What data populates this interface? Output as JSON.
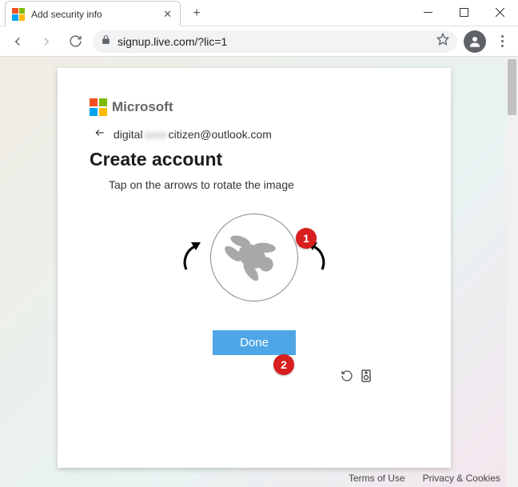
{
  "browser": {
    "tab_title": "Add security info",
    "url": "signup.live.com/?lic=1"
  },
  "page": {
    "brand": "Microsoft",
    "email_prefix": "digital",
    "email_blur": "xxxx",
    "email_suffix": "citizen@outlook.com",
    "heading": "Create account",
    "instruction": "Tap on the arrows to rotate the image",
    "done_label": "Done"
  },
  "annotations": {
    "step1": "1",
    "step2": "2"
  },
  "footer": {
    "terms": "Terms of Use",
    "privacy": "Privacy & Cookies"
  }
}
